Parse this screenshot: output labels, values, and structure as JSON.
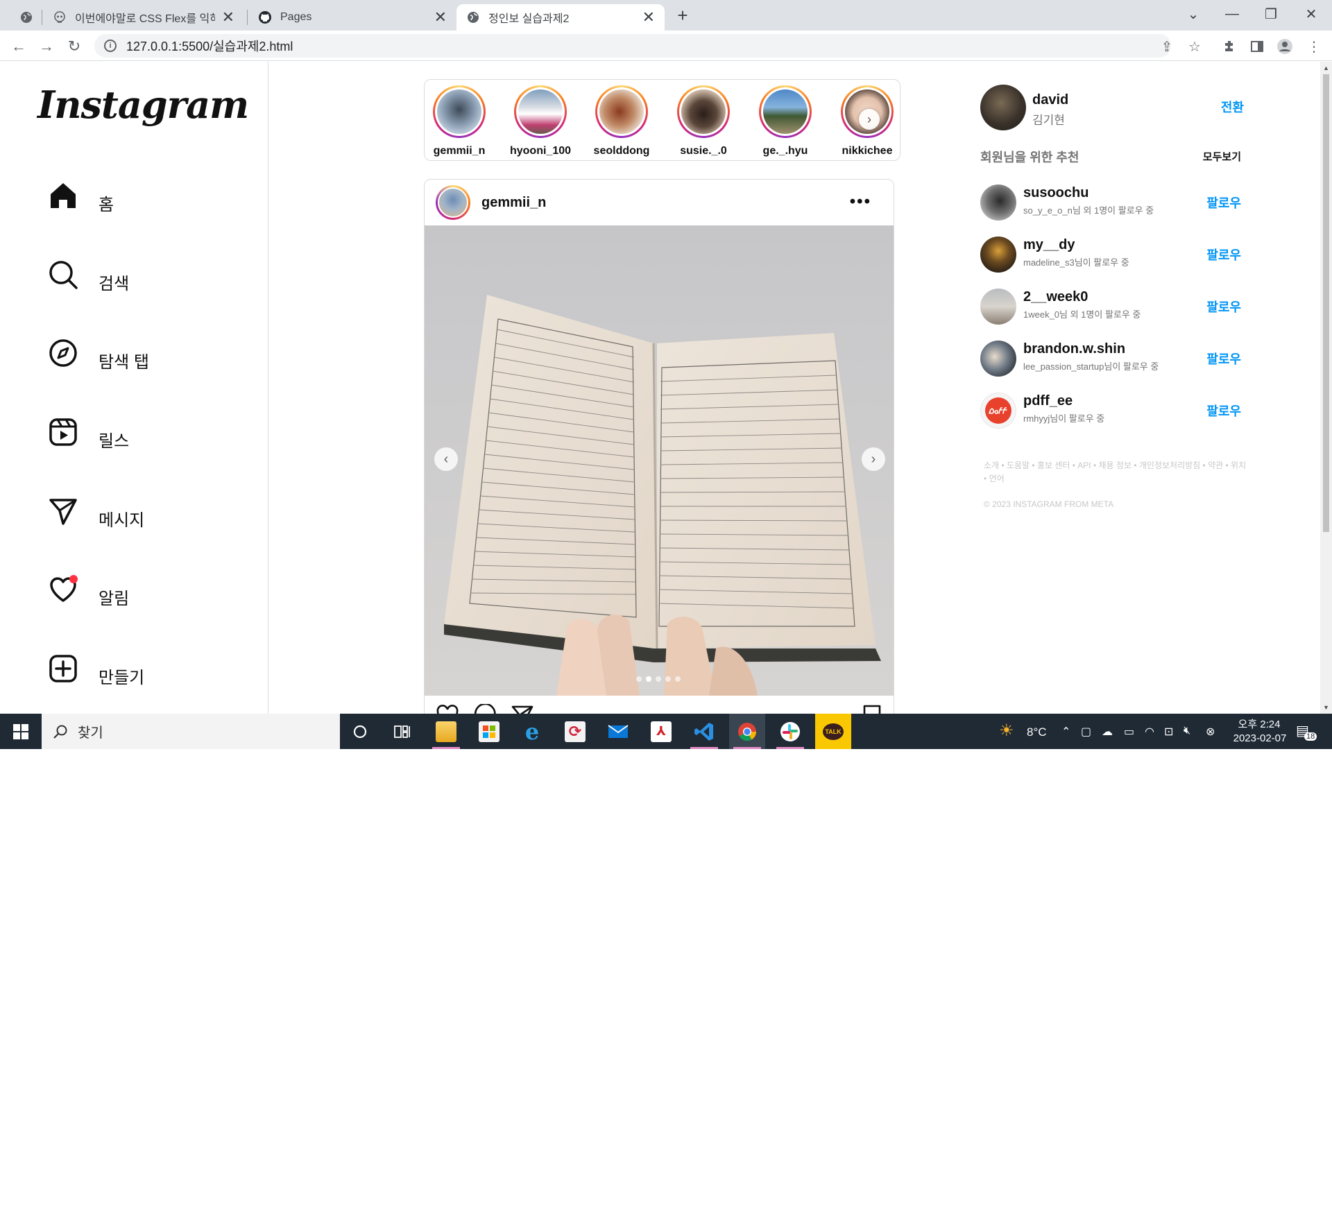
{
  "browser": {
    "tabs": [
      {
        "title": "이번에야말로 CSS Flex를 익혀보",
        "close": "✕"
      },
      {
        "title": "Pages",
        "close": "✕"
      },
      {
        "title": "정인보 실습과제2",
        "close": "✕"
      }
    ],
    "new_tab": "+",
    "url": "127.0.0.1:5500/실습과제2.html"
  },
  "sidebar": {
    "logo": "Instagram",
    "items": [
      {
        "label": "홈",
        "icon": "home-icon"
      },
      {
        "label": "검색",
        "icon": "search-icon"
      },
      {
        "label": "탐색 탭",
        "icon": "compass-icon"
      },
      {
        "label": "릴스",
        "icon": "reels-icon"
      },
      {
        "label": "메시지",
        "icon": "send-icon"
      },
      {
        "label": "알림",
        "icon": "heart-icon"
      },
      {
        "label": "만들기",
        "icon": "plus-square-icon"
      }
    ]
  },
  "stories": [
    {
      "user": "gemmii_n"
    },
    {
      "user": "hyooni_100"
    },
    {
      "user": "seolddong"
    },
    {
      "user": "susie._.0"
    },
    {
      "user": "ge._.hyu"
    },
    {
      "user": "nikkichee"
    }
  ],
  "post": {
    "user": "gemmii_n",
    "more": "•••",
    "slide_count": 5,
    "active_slide": 2
  },
  "profile": {
    "username": "david",
    "name": "김기현",
    "switch_label": "전환"
  },
  "suggestions": {
    "title": "회원님을 위한 추천",
    "see_all": "모두보기",
    "follow_label": "팔로우",
    "items": [
      {
        "username": "susoochu",
        "sub": "so_y_e_o_n님 외 1명이 팔로우 중"
      },
      {
        "username": "my__dy",
        "sub": "madeline_s3님이 팔로우 중"
      },
      {
        "username": "2__week0",
        "sub": "1week_0님 외 1명이 팔로우 중"
      },
      {
        "username": "brandon.w.shin",
        "sub": "lee_passion_startup님이 팔로우 중"
      },
      {
        "username": "pdff_ee",
        "sub": "rmhyyj님이 팔로우 중"
      }
    ]
  },
  "footer": {
    "links": "소개 • 도움말 • 홍보 센터 • API • 채용 정보 • 개인정보처리방침 • 약관 • 위치 • 언어",
    "copyright": "© 2023 INSTAGRAM FROM META"
  },
  "taskbar": {
    "search_placeholder": "찾기",
    "weather": "8°C",
    "time": "오후 2:24",
    "date": "2023-02-07",
    "notifications": "18"
  },
  "colors": {
    "accent_blue": "#0095f6",
    "taskbar": "#1f2a35",
    "notif_dot": "#ff3040"
  }
}
